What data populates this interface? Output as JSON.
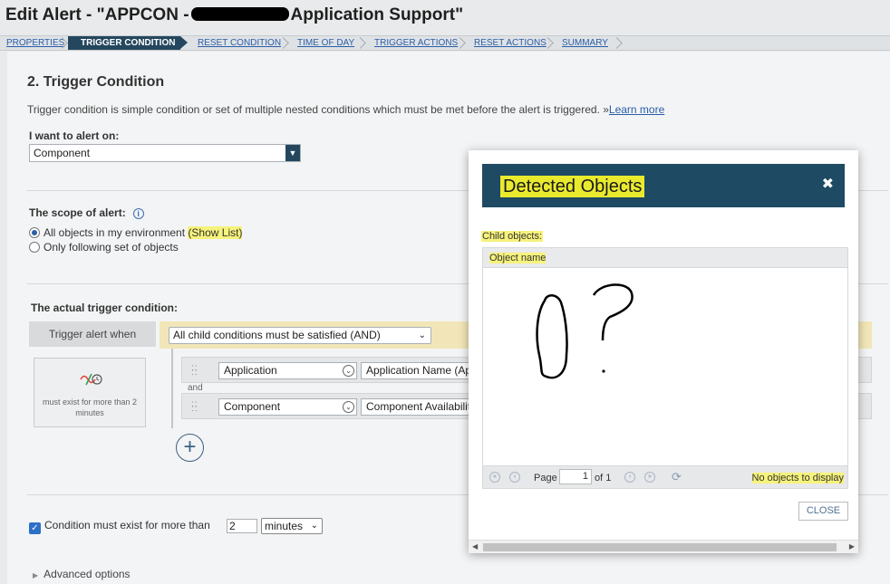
{
  "page": {
    "title_prefix": "Edit Alert - \"APPCON -",
    "title_suffix": "Application Support\""
  },
  "wizard": {
    "steps": [
      {
        "label": "PROPERTIES",
        "active": false
      },
      {
        "label": "TRIGGER CONDITION",
        "active": true
      },
      {
        "label": "RESET CONDITION",
        "active": false
      },
      {
        "label": "TIME OF DAY",
        "active": false
      },
      {
        "label": "TRIGGER ACTIONS",
        "active": false
      },
      {
        "label": "RESET ACTIONS",
        "active": false
      },
      {
        "label": "SUMMARY",
        "active": false
      }
    ]
  },
  "trigger": {
    "heading": "2. Trigger Condition",
    "description": "Trigger condition is simple condition or set of multiple nested conditions which must be met before the alert is triggered. »",
    "learn_more": "Learn more",
    "alert_on_label": "I want to alert on:",
    "alert_on_value": "Component",
    "scope_label": "The scope of alert:",
    "scope_all": "All objects in my environment",
    "scope_show_list": "(Show List)",
    "scope_following": "Only following set of objects",
    "actual_label": "The actual trigger condition:",
    "trigger_when": "Trigger alert when",
    "condition_mode": "All child conditions must be satisfied (AND)",
    "must_exist_text": "must exist for more than 2 minutes",
    "and_label": "and",
    "rows": [
      {
        "field": "Application",
        "value": "Application Name (Ap"
      },
      {
        "field": "Component",
        "value": "Component Availabilit"
      }
    ],
    "condition_exist_label": "Condition must exist for more than",
    "condition_exist_value": "2",
    "condition_exist_unit": "minutes",
    "advanced": "Advanced options"
  },
  "modal": {
    "title": "Detected Objects",
    "child_objects": "Child objects:",
    "column_header": "Object name",
    "page_label": "Page",
    "page_value": "1",
    "of_label": "of 1",
    "no_objects": "No objects to display",
    "close": "CLOSE"
  },
  "colors": {
    "header_navy": "#1e4a63",
    "highlight_yellow": "#f6f27b",
    "link_blue": "#2b5ea8",
    "condition_bar": "#f2e6b8"
  }
}
